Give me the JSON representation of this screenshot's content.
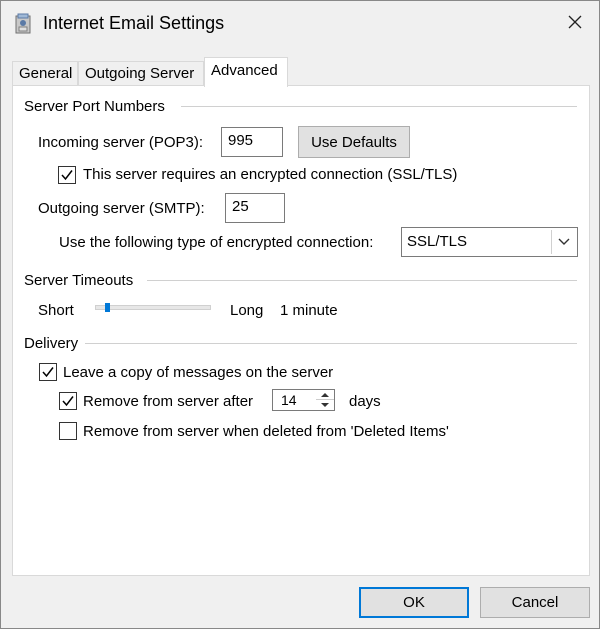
{
  "window": {
    "title": "Internet Email Settings"
  },
  "tabs": [
    {
      "label": "General"
    },
    {
      "label": "Outgoing Server"
    },
    {
      "label": "Advanced"
    }
  ],
  "server_ports": {
    "section_title": "Server Port Numbers",
    "incoming_label": "Incoming server (POP3):",
    "incoming_value": "995",
    "use_defaults_label": "Use Defaults",
    "ssl_checkbox_label": "This server requires an encrypted connection (SSL/TLS)",
    "ssl_checked": true,
    "outgoing_label": "Outgoing server (SMTP):",
    "outgoing_value": "25",
    "encryption_label": "Use the following type of encrypted connection:",
    "encryption_value": "SSL/TLS"
  },
  "timeouts": {
    "section_title": "Server Timeouts",
    "short_label": "Short",
    "long_label": "Long",
    "value_label": "1 minute",
    "slider_position": 0.05
  },
  "delivery": {
    "section_title": "Delivery",
    "leave_copy_label": "Leave a copy of messages on the server",
    "leave_copy_checked": true,
    "remove_after_label": "Remove from server after",
    "remove_after_checked": true,
    "remove_after_days": "14",
    "days_label": "days",
    "remove_deleted_label": "Remove from server when deleted from 'Deleted Items'",
    "remove_deleted_checked": false
  },
  "footer": {
    "ok_label": "OK",
    "cancel_label": "Cancel"
  },
  "colors": {
    "accent": "#0078d7"
  }
}
